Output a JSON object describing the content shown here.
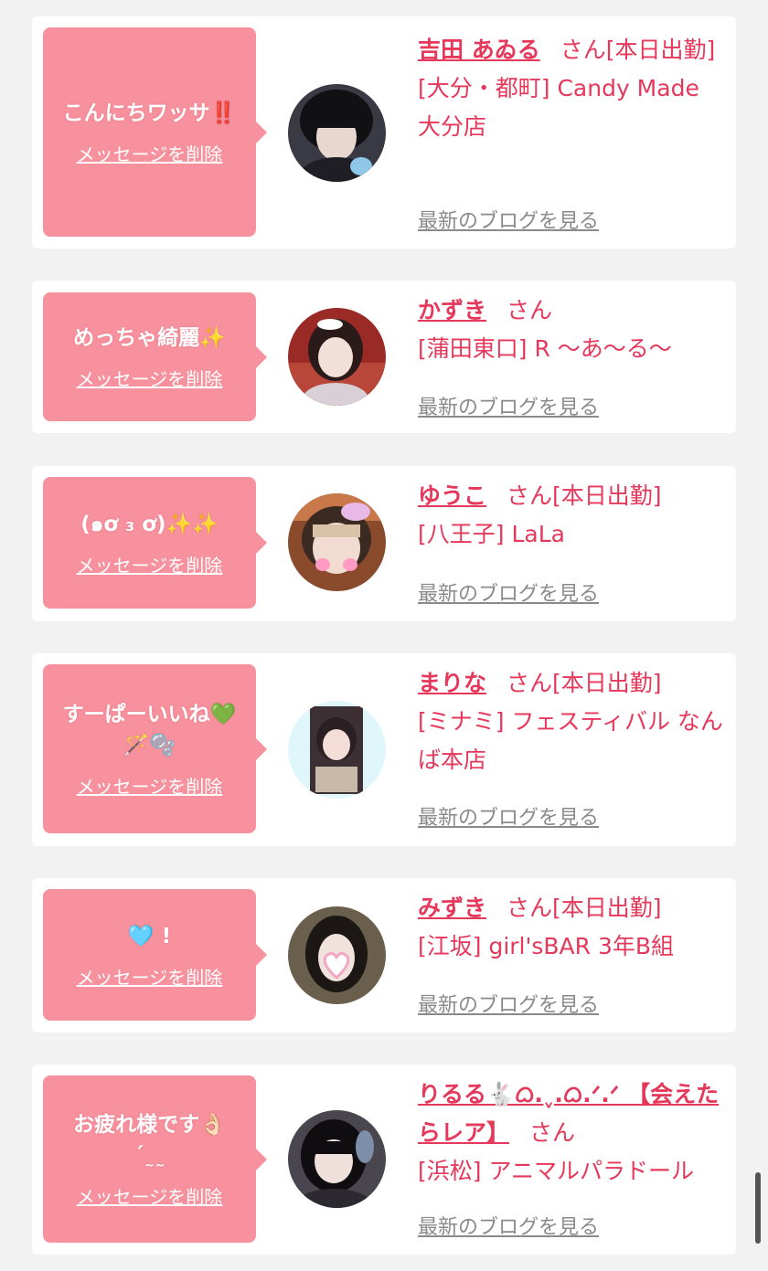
{
  "common": {
    "delete_label": "メッセージを削除",
    "blog_label": "最新のブログを見る",
    "san": "さん",
    "bubble_color": "#f7919d",
    "name_color": "#e5385a"
  },
  "messages": [
    {
      "bubble_text": "こんにちワッサ‼️",
      "name": "吉田 あゐる",
      "attendance": "[本日出勤]",
      "shop": "[大分・都町] Candy Made 大分店",
      "avatar_icon": "girl-avatar"
    },
    {
      "bubble_text": "めっちゃ綺麗✨",
      "name": "かずき",
      "attendance": "",
      "shop": "[蒲田東口] R 〜あ〜る〜",
      "avatar_icon": "girl-avatar"
    },
    {
      "bubble_text": "(๑ơ ₃ ơ)✨✨",
      "name": "ゆうこ",
      "attendance": "[本日出勤]",
      "shop": "[八王子] LaLa",
      "avatar_icon": "girl-avatar"
    },
    {
      "bubble_text": "すーぱーいいね💚🪄🫧",
      "name": "まりな",
      "attendance": "[本日出勤]",
      "shop": "[ミナミ] フェスティバル なんば本店",
      "avatar_icon": "girl-avatar"
    },
    {
      "bubble_text": "🩵 !",
      "name": "みずき",
      "attendance": "[本日出勤]",
      "shop": "[江坂] girl'sBAR 3年B組",
      "avatar_icon": "girl-avatar"
    },
    {
      "bubble_text": "お疲れ様です👌🏻 ˊ˷˷",
      "name": "りるる🐇ᜊ.ˬ.ᜊ.ᐟ.ᐟ 【会えたらレア】",
      "attendance": "",
      "shop": "[浜松] アニマルパラドール",
      "avatar_icon": "girl-avatar"
    }
  ]
}
